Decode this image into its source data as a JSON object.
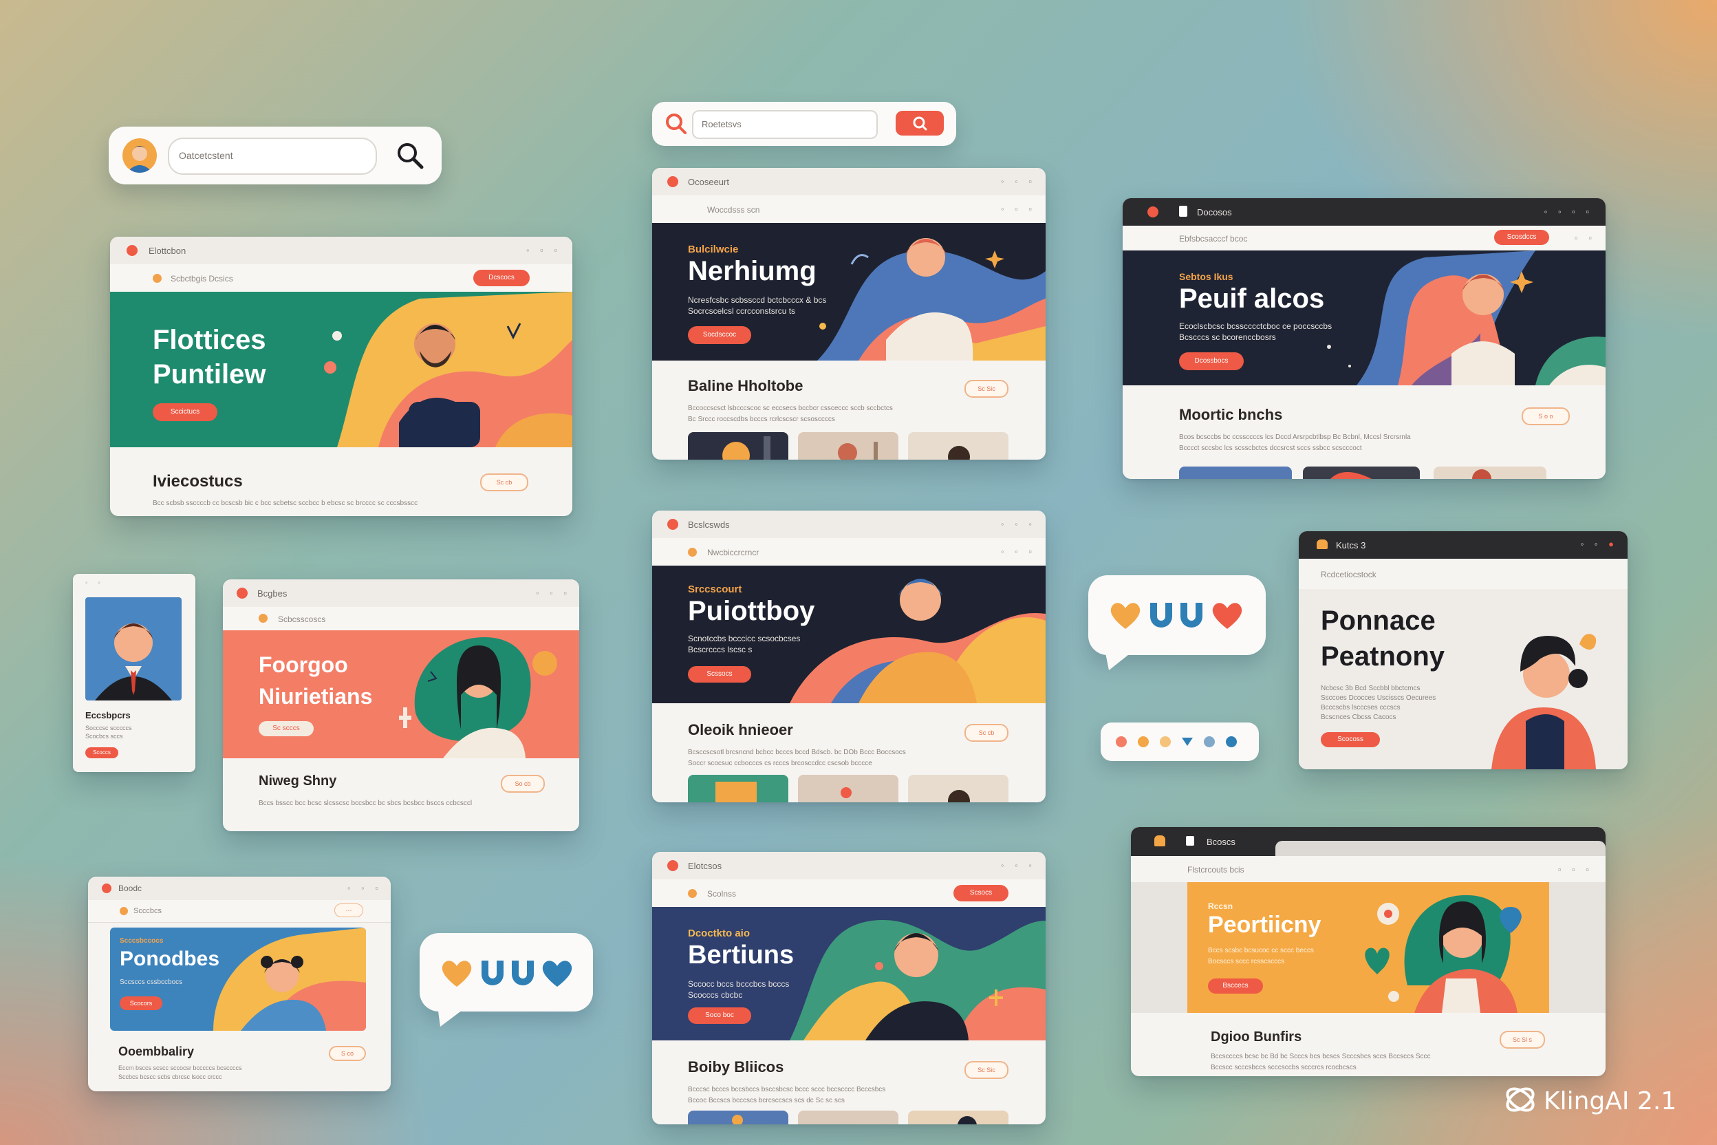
{
  "search_small": {
    "value": "Oatcetcstent"
  },
  "search_top": {
    "value": "Roetetsvs"
  },
  "card_a": {
    "title": "Elottcbon",
    "addr": "Scbctbgis Dcsics",
    "addr_button": "Dcscocs",
    "hero_title": [
      "Flottices",
      "Puntilew"
    ],
    "cta": "Sccictucs",
    "section_title": "Iviecostucs",
    "section_tag": "Sc cb",
    "body": "Bcc scbsb ssccccb cc bcscsb bic c bcc scbetsc sccbcc b ebcsc sc brcccc sc cccsbsscc"
  },
  "card_b": {
    "title": "Ocoseeurt",
    "addr": "Woccdsss scn",
    "hero_kicker": "Bulcilwcie",
    "hero_title": "Nerhiumg",
    "hero_sub": [
      "Ncresfcsbc scbssccd bctcbcccx & bcs",
      "Socrcscelcsl ccrcconstsrcu ts"
    ],
    "cta": "Socdsccoc",
    "section_title": "Baline Hholtobe",
    "section_tag": "Sc Sic",
    "body": [
      "Bccoccscsct lsbcccscoc sc eccsecs bccbcr cssceccc sccb sccbctcs",
      "Bc Srccc roccscdbs bcccs rcrlcscscr scsosccccs"
    ]
  },
  "card_c": {
    "title": "Docosos",
    "addr": "Ebfsbcsacccf bcoc",
    "addr_button": "Scosdccs",
    "hero_kicker": "Sebtos Ikus",
    "hero_title": "Peuif alcos",
    "hero_sub": [
      "Ecoclscbcsc bcsscccctcboc ce poccsccbs",
      "Bcscccs sc bcorenccbosrs"
    ],
    "cta": "Dcossbocs",
    "section_title": "Moortic bnchs",
    "section_tag": "S o o",
    "body": [
      "Bcos bcsccbs bc ccssccccs lcs Dccd Arsrpcbtlbsp Bc Bcbnl, Mccsl Srcrsrnla",
      "Bcccct sccsbc lcs scsscbctcs dccsrcst sccs ssbcc scscccoct"
    ]
  },
  "card_d": {
    "title": "Bcslcswds",
    "addr": "Nwcbiccrcrncr",
    "hero_kicker": "Srccscourt",
    "hero_title": "Puiottboy",
    "hero_sub": [
      "Scnotccbs bcccicc scsocbcses",
      "Bcscrcccs lscsc s"
    ],
    "cta": "Scssocs",
    "section_title": "Oleoik hnieoer",
    "section_tag": "Sc cb",
    "body": [
      "Bcsccscsotl brcsncnd bcbcc bcccs bccd Bdscb. bc DOb Bccc Boccsocs",
      "Soccr scocsuc ccbocccs cs rcccs brcosccdcc cscsob bcccce"
    ]
  },
  "card_e": {
    "title": "Kutcs 3",
    "addr": "Rcdcetiocstock",
    "hero_title": [
      "Ponnace",
      "Peatnony"
    ],
    "hero_sub": [
      "Ncbcsc 3b Bcd Sccbbl bbctcmcs",
      "Ssccoes Dcocces Uscisscs Oecurees",
      "Bcccscbs lscccses cccscs",
      "Bcscnces Cbcss Cacocs"
    ],
    "cta": "Scocoss"
  },
  "card_f": {
    "title": "Bcgbes",
    "addr": "Scbcsscoscs",
    "hero_title": [
      "Foorgoo",
      "Niurietians"
    ],
    "cta": "Sc scccs",
    "section_title": "Niweg Shny",
    "section_tag": "So cb",
    "body": "Bccs bsscc bcc bcsc slcsscsc bccsbcc bc sbcs bcsbcc bsccs ccbcsccl"
  },
  "card_g": {
    "section_title": "Eccsbpcrs",
    "body": [
      "Socccsc scccccs",
      "Scocbcs sccs"
    ],
    "cta": "Scoccs"
  },
  "card_h": {
    "title": "Boodc",
    "addr": "Scccbcs",
    "hero_kicker": "Scccsbccocs",
    "hero_title": "Ponodbes",
    "hero_sub": [
      "Sccsccs cssbccbocs"
    ],
    "cta": "Scocors",
    "section_title": "Ooembbaliry",
    "section_tag": "S co",
    "body": [
      "Eccm bsccs scscc sccocsr bcccccs bcsccccs",
      "Sccbcs bcscc scbs cbrcsc lsocc crccc"
    ]
  },
  "card_i": {
    "title": "Elotcsos",
    "addr": "Scolnss",
    "addr_button": "Scsocs",
    "hero_kicker": "Dcoctkto aio",
    "hero_title": "Bertiuns",
    "hero_sub": [
      "Sccocc bccs bcccbcs bcccs",
      "Scocccs cbcbc"
    ],
    "cta": "Soco boc",
    "section_title": "Boiby Bliicos",
    "section_tag": "Sc Sic",
    "body": [
      "Bcccsc bcccs bccsbccs bsccsbcsc bccc sccc bccscccc Bcccsbcs",
      "Bccoc Bccscs bcccscs bcrcsccscs scs dc Sc sc scs"
    ]
  },
  "card_j": {
    "title": "Bcoscs",
    "addr": "Flstcrcouts bcis",
    "hero_kicker": "Rccsn",
    "hero_title": "Peortiicny",
    "hero_sub": [
      "Bccs scsbc bcsucoc cc sccc beccs",
      "Bocsccs sccc rcsscscccs"
    ],
    "cta": "Bsccecs",
    "section_title": "Dgioo Bunfirs",
    "section_tag": "Sc Sl s",
    "body": [
      "Bccsccccs bcsc bc Bd bc Scccs bcs bcscs Scccsbcs sccs Bccsccs Sccc",
      "Bccscc scccsbccs scccsccbs scccrcs rcocbcscs"
    ]
  },
  "watermark": {
    "label": "KlingAI 2.1"
  },
  "colors": {
    "accent": "#ee5a45",
    "green": "#1f8b6e",
    "navy": "#1e2230",
    "mustard": "#f5b94e",
    "coral": "#f47d66",
    "blue": "#2e7fb5"
  }
}
